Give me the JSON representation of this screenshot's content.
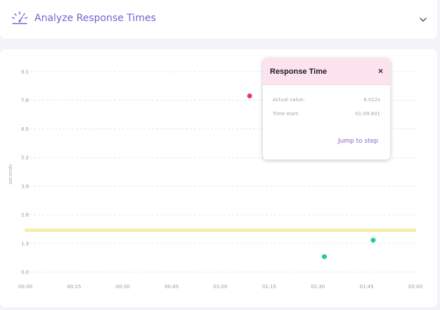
{
  "header": {
    "title": "Analyze Response Times",
    "icon": "speedometer-icon",
    "expand_icon": "chevron-down-icon"
  },
  "chart_data": {
    "type": "scatter",
    "title": "",
    "xlabel": "",
    "ylabel": "seconds",
    "x_ticks": [
      "00:00",
      "00:15",
      "00:30",
      "00:45",
      "01:00",
      "01:15",
      "01:30",
      "01:45",
      "02:00"
    ],
    "y_ticks": [
      "0.0",
      "1.3",
      "2.6",
      "3.9",
      "5.2",
      "6.5",
      "7.8",
      "9.1"
    ],
    "xlim_seconds": [
      0,
      120
    ],
    "ylim": [
      0,
      9.1
    ],
    "grid": true,
    "points": [
      {
        "x": "01:09",
        "x_seconds": 69,
        "y": 8.0,
        "color": "#e0338a"
      },
      {
        "x": "01:32",
        "x_seconds": 92,
        "y": 0.7,
        "color": "#1fcf9a"
      },
      {
        "x": "01:47",
        "x_seconds": 107,
        "y": 1.45,
        "color": "#1fcf9a"
      }
    ],
    "threshold": {
      "y": 1.9,
      "color": "#e8d94a"
    }
  },
  "popup": {
    "title": "Response Time",
    "close_label": "×",
    "rows": [
      {
        "label": "Actual value:",
        "value": "8.012s"
      },
      {
        "label": "Time start:",
        "value": "01:09.801"
      }
    ],
    "link_label": "Jump to step"
  },
  "colors": {
    "accent": "#7a5fd0",
    "popup_header": "#fde3ee",
    "point_selected": "#e0338a",
    "point_ok": "#1fcf9a",
    "threshold": "#e8d94a"
  }
}
